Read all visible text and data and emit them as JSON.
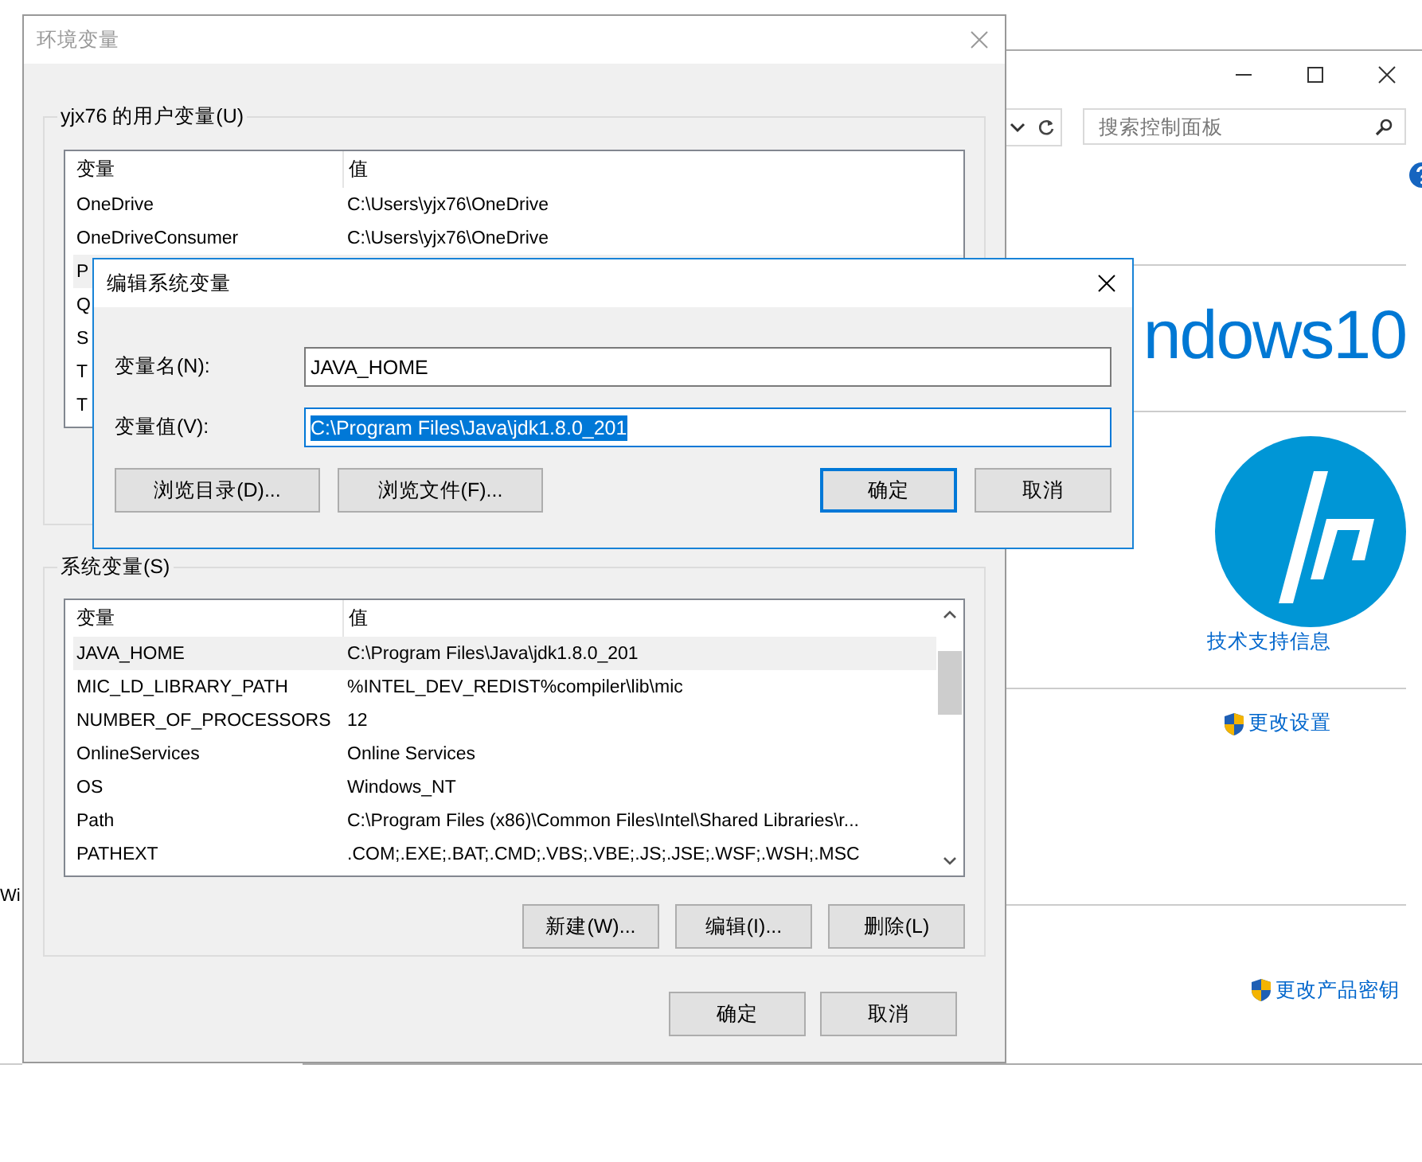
{
  "left_window": {
    "text": "Wi"
  },
  "control_panel": {
    "search": {
      "placeholder": "搜索控制面板"
    },
    "brand_text": "ndows10",
    "support_link": "技术支持信息",
    "settings_link": "更改设置",
    "product_key_link": "更改产品密钥"
  },
  "env_window": {
    "title": "环境变量",
    "active": false,
    "user_vars": {
      "title": "yjx76 的用户变量(U)",
      "columns": [
        "变量",
        "值"
      ],
      "rows": [
        {
          "name": "OneDrive",
          "value": "C:\\Users\\yjx76\\OneDrive",
          "selected": false
        },
        {
          "name": "OneDriveConsumer",
          "value": "C:\\Users\\yjx76\\OneDrive",
          "selected": false
        },
        {
          "name": "P",
          "selected": true
        },
        {
          "name": "Q",
          "selected": false
        },
        {
          "name": "S",
          "selected": false
        },
        {
          "name": "T",
          "selected": false
        },
        {
          "name": "T",
          "selected": false
        }
      ]
    },
    "system_vars": {
      "title": "系统变量(S)",
      "columns": [
        "变量",
        "值"
      ],
      "rows": [
        {
          "name": "JAVA_HOME",
          "value": "C:\\Program Files\\Java\\jdk1.8.0_201",
          "selected": true
        },
        {
          "name": "MIC_LD_LIBRARY_PATH",
          "value": "%INTEL_DEV_REDIST%compiler\\lib\\mic",
          "selected": false
        },
        {
          "name": "NUMBER_OF_PROCESSORS",
          "value": "12",
          "selected": false
        },
        {
          "name": "OnlineServices",
          "value": "Online Services",
          "selected": false
        },
        {
          "name": "OS",
          "value": "Windows_NT",
          "selected": false
        },
        {
          "name": "Path",
          "value": "C:\\Program Files (x86)\\Common Files\\Intel\\Shared Libraries\\r...",
          "selected": false
        },
        {
          "name": "PATHEXT",
          "value": ".COM;.EXE;.BAT;.CMD;.VBS;.VBE;.JS;.JSE;.WSF;.WSH;.MSC",
          "selected": false
        }
      ],
      "buttons": [
        "新建(W)...",
        "编辑(I)...",
        "删除(L)"
      ]
    },
    "buttons": [
      "确定",
      "取消"
    ]
  },
  "edit_dialog": {
    "title": "编辑系统变量",
    "active": true,
    "fields": [
      {
        "label": "变量名(N):",
        "value": "JAVA_HOME",
        "selected": false
      },
      {
        "label": "变量值(V):",
        "value": "C:\\Program Files\\Java\\jdk1.8.0_201",
        "selected": true
      }
    ],
    "browse_buttons": [
      "浏览目录(D)...",
      "浏览文件(F)..."
    ],
    "buttons": [
      {
        "label": "确定",
        "default": true
      },
      {
        "label": "取消",
        "default": false
      }
    ]
  }
}
